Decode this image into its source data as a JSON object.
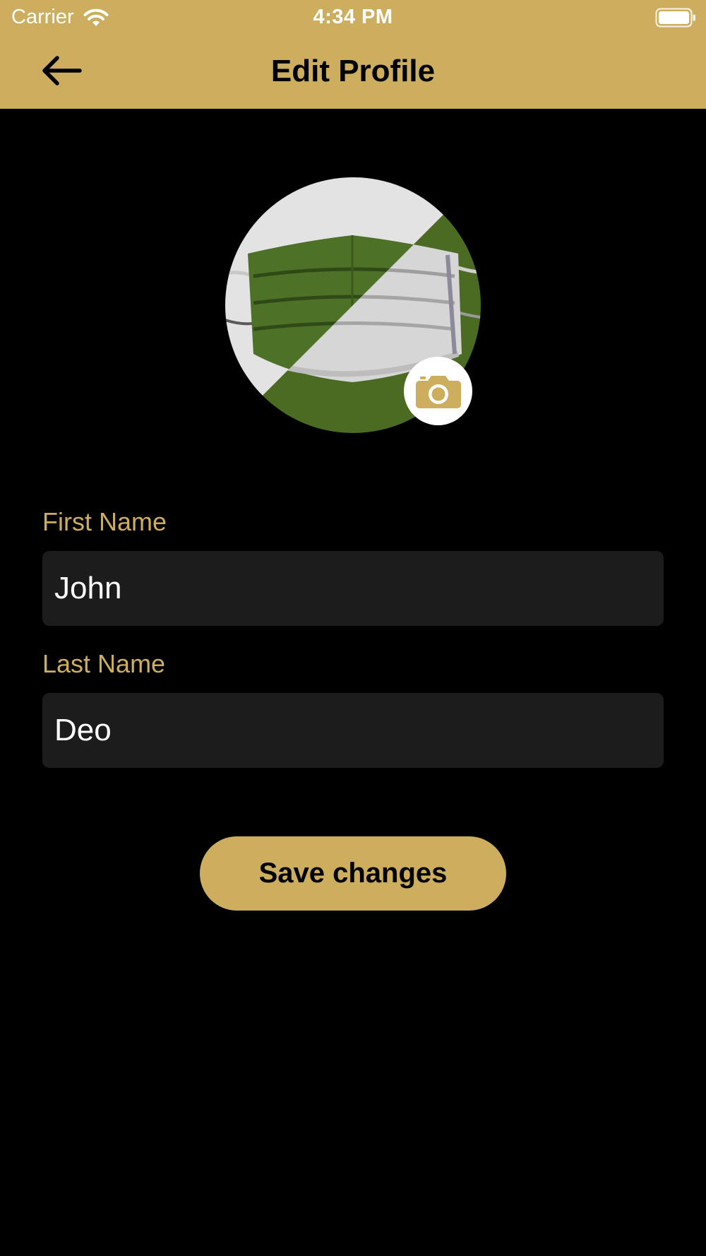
{
  "status_bar": {
    "carrier": "Carrier",
    "time": "4:34 PM",
    "wifi_icon": "wifi-icon",
    "battery_icon": "battery-full-icon"
  },
  "header": {
    "title": "Edit Profile",
    "back_icon": "arrow-left-icon"
  },
  "profile": {
    "avatar_description_icon": "avatar-image",
    "camera_icon": "camera-icon"
  },
  "form": {
    "first_name": {
      "label": "First Name",
      "value": "John"
    },
    "last_name": {
      "label": "Last Name",
      "value": "Deo"
    }
  },
  "actions": {
    "save_label": "Save changes"
  },
  "colors": {
    "accent": "#CDAE5E",
    "background": "#000000",
    "field_background": "#1C1C1C",
    "text_primary": "#FFFFFF"
  }
}
